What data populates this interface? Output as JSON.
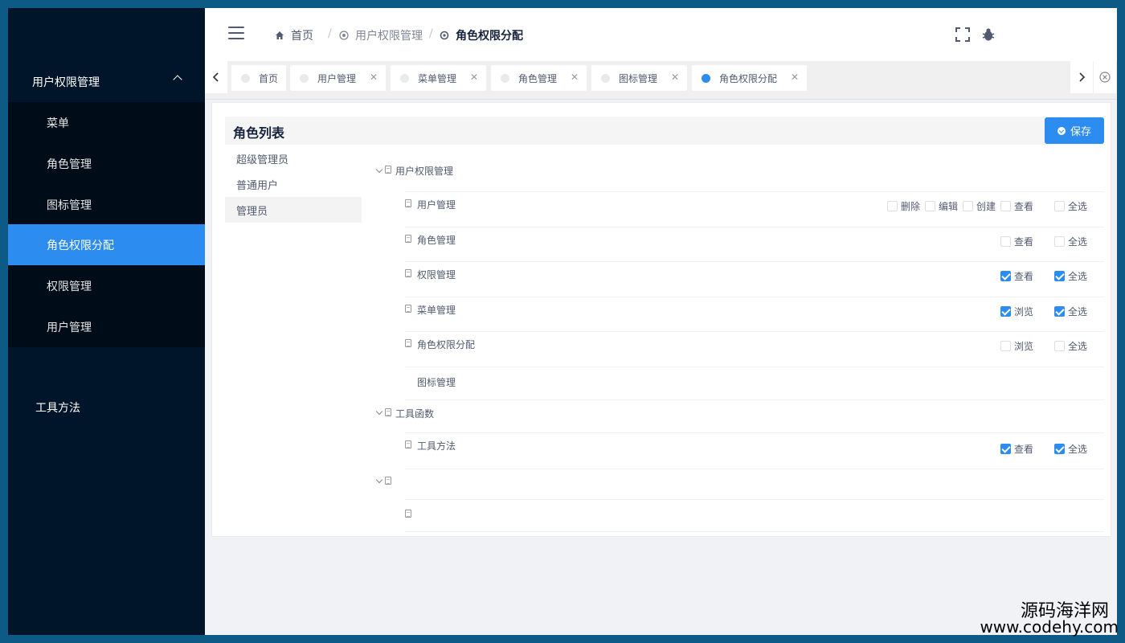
{
  "sidebar": {
    "group1": {
      "label": "用户权限管理"
    },
    "items": [
      {
        "label": "菜单"
      },
      {
        "label": "角色管理"
      },
      {
        "label": "图标管理"
      },
      {
        "label": "角色权限分配",
        "active": true
      },
      {
        "label": "权限管理"
      },
      {
        "label": "用户管理"
      }
    ],
    "group2": {
      "label": "工具方法"
    }
  },
  "header": {
    "breadcrumb": [
      {
        "label": "首页",
        "icon": "home-icon"
      },
      {
        "label": "用户权限管理",
        "icon": "category-icon"
      },
      {
        "label": "角色权限分配",
        "icon": "settings-icon"
      }
    ],
    "icons": [
      "fullscreen-icon",
      "bug-icon"
    ]
  },
  "tabs": [
    {
      "label": "首页",
      "closable": false
    },
    {
      "label": "用户管理",
      "closable": true
    },
    {
      "label": "菜单管理",
      "closable": true
    },
    {
      "label": "角色管理",
      "closable": true
    },
    {
      "label": "图标管理",
      "closable": true
    },
    {
      "label": "角色权限分配",
      "closable": true,
      "active": true
    }
  ],
  "card": {
    "title": "角色列表",
    "save_label": "保存",
    "roles": [
      {
        "label": "超级管理员"
      },
      {
        "label": "普通用户"
      },
      {
        "label": "管理员",
        "selected": true
      }
    ]
  },
  "tree": {
    "group1": {
      "label": "用户权限管理",
      "children": [
        {
          "label": "用户管理",
          "perms": [
            {
              "label": "删除",
              "checked": false
            },
            {
              "label": "编辑",
              "checked": false
            },
            {
              "label": "创建",
              "checked": false
            },
            {
              "label": "查看",
              "checked": false
            }
          ],
          "all": {
            "label": "全选",
            "checked": false
          }
        },
        {
          "label": "角色管理",
          "perms": [
            {
              "label": "查看",
              "checked": false
            }
          ],
          "all": {
            "label": "全选",
            "checked": false
          }
        },
        {
          "label": "权限管理",
          "perms": [
            {
              "label": "查看",
              "checked": true
            }
          ],
          "all": {
            "label": "全选",
            "checked": true
          }
        },
        {
          "label": "菜单管理",
          "perms": [
            {
              "label": "浏览",
              "checked": true
            }
          ],
          "all": {
            "label": "全选",
            "checked": true
          }
        },
        {
          "label": "角色权限分配",
          "perms": [
            {
              "label": "浏览",
              "checked": false
            }
          ],
          "all": {
            "label": "全选",
            "checked": false
          }
        },
        {
          "label": "图标管理"
        }
      ]
    },
    "group2": {
      "label": "工具函数",
      "children": [
        {
          "label": "工具方法",
          "perms": [
            {
              "label": "查看",
              "checked": true
            }
          ],
          "all": {
            "label": "全选",
            "checked": true
          }
        }
      ]
    }
  },
  "watermark": {
    "line1": "源码海洋网",
    "line2": "www.codehy.com"
  },
  "colors": {
    "sidebar_bg": "#001529",
    "submenu_bg": "#000c17",
    "accent": "#2d8cf0",
    "frame": "#0d5a86"
  }
}
